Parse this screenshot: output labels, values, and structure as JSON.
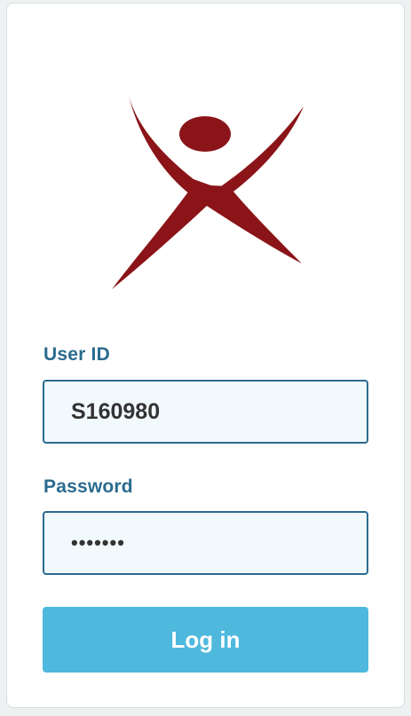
{
  "logo": {
    "icon": "person-x-logo",
    "color": "#8b1418"
  },
  "form": {
    "user_id_label": "User ID",
    "user_id_value": "S160980",
    "password_label": "Password",
    "password_value": "•••••••",
    "login_label": "Log in"
  },
  "colors": {
    "label": "#2a6b8f",
    "field_border": "#2a6b8f",
    "field_bg": "#f2f9fc",
    "button_bg": "#4fb8dd",
    "button_text": "#ffffff"
  }
}
